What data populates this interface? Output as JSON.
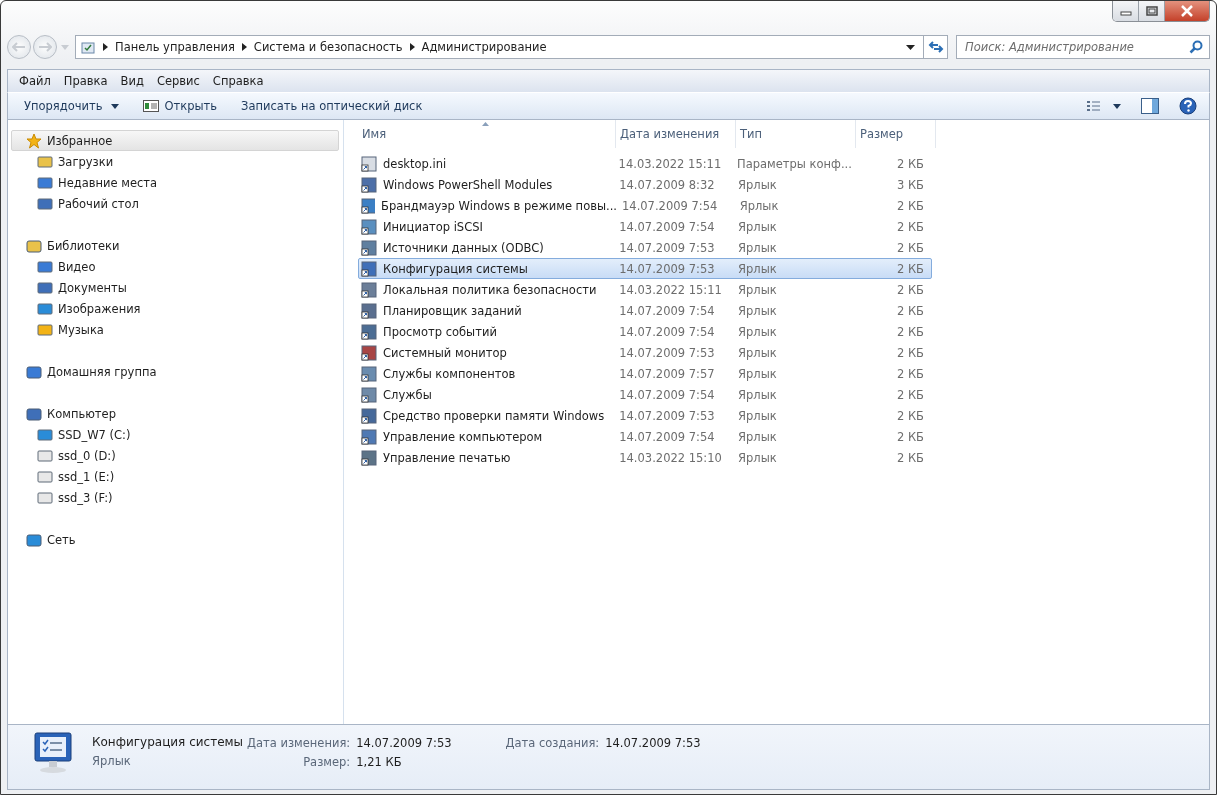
{
  "address_bar": {
    "breadcrumb": [
      "Панель управления",
      "Система и безопасность",
      "Администрирование"
    ]
  },
  "search": {
    "placeholder": "Поиск: Администрирование"
  },
  "menu": [
    "Файл",
    "Правка",
    "Вид",
    "Сервис",
    "Справка"
  ],
  "toolbar": [
    {
      "label": "Упорядочить",
      "kind": "dropdown"
    },
    {
      "label": "Открыть",
      "kind": "icon"
    },
    {
      "label": "Записать на оптический диск",
      "kind": "plain"
    }
  ],
  "sidebar": [
    {
      "label": "Избранное",
      "selected": true,
      "children": [
        {
          "label": "Загрузки",
          "selected": false
        },
        {
          "label": "Недавние места",
          "selected": false
        },
        {
          "label": "Рабочий стол",
          "selected": false
        }
      ]
    },
    {
      "label": "Библиотеки",
      "selected": false,
      "children": [
        {
          "label": "Видео",
          "selected": false
        },
        {
          "label": "Документы",
          "selected": false
        },
        {
          "label": "Изображения",
          "selected": false
        },
        {
          "label": "Музыка",
          "selected": false
        }
      ]
    },
    {
      "label": "Домашняя группа",
      "selected": false
    },
    {
      "label": "Компьютер",
      "selected": false,
      "children": [
        {
          "label": "SSD_W7 (C:)",
          "selected": false
        },
        {
          "label": "ssd_0 (D:)",
          "selected": false
        },
        {
          "label": "ssd_1 (E:)",
          "selected": false
        },
        {
          "label": "ssd_3 (F:)",
          "selected": false
        }
      ]
    },
    {
      "label": "Сеть",
      "selected": false
    }
  ],
  "table": {
    "columns": [
      "Имя",
      "Дата изменения",
      "Тип",
      "Размер"
    ],
    "rows": [
      {
        "cells": [
          "desktop.ini",
          "14.03.2022 15:11",
          "Параметры конф...",
          "2 КБ"
        ],
        "selected": false
      },
      {
        "cells": [
          "Windows PowerShell Modules",
          "14.07.2009 8:32",
          "Ярлык",
          "3 КБ"
        ],
        "selected": false
      },
      {
        "cells": [
          "Брандмауэр Windows в режиме повы...",
          "14.07.2009 7:54",
          "Ярлык",
          "2 КБ"
        ],
        "selected": false
      },
      {
        "cells": [
          "Инициатор iSCSI",
          "14.07.2009 7:54",
          "Ярлык",
          "2 КБ"
        ],
        "selected": false
      },
      {
        "cells": [
          "Источники данных (ODBC)",
          "14.07.2009 7:53",
          "Ярлык",
          "2 КБ"
        ],
        "selected": false
      },
      {
        "cells": [
          "Конфигурация системы",
          "14.07.2009 7:53",
          "Ярлык",
          "2 КБ"
        ],
        "selected": true
      },
      {
        "cells": [
          "Локальная политика безопасности",
          "14.03.2022 15:11",
          "Ярлык",
          "2 КБ"
        ],
        "selected": false
      },
      {
        "cells": [
          "Планировщик заданий",
          "14.07.2009 7:54",
          "Ярлык",
          "2 КБ"
        ],
        "selected": false
      },
      {
        "cells": [
          "Просмотр событий",
          "14.07.2009 7:54",
          "Ярлык",
          "2 КБ"
        ],
        "selected": false
      },
      {
        "cells": [
          "Системный монитор",
          "14.07.2009 7:53",
          "Ярлык",
          "2 КБ"
        ],
        "selected": false
      },
      {
        "cells": [
          "Службы компонентов",
          "14.07.2009 7:57",
          "Ярлык",
          "2 КБ"
        ],
        "selected": false
      },
      {
        "cells": [
          "Службы",
          "14.07.2009 7:54",
          "Ярлык",
          "2 КБ"
        ],
        "selected": false
      },
      {
        "cells": [
          "Средство проверки памяти Windows",
          "14.07.2009 7:53",
          "Ярлык",
          "2 КБ"
        ],
        "selected": false
      },
      {
        "cells": [
          "Управление компьютером",
          "14.07.2009 7:54",
          "Ярлык",
          "2 КБ"
        ],
        "selected": false
      },
      {
        "cells": [
          "Управление печатью",
          "14.03.2022 15:10",
          "Ярлык",
          "2 КБ"
        ],
        "selected": false
      }
    ]
  },
  "details": {
    "name": "Конфигурация системы",
    "type": "Ярлык",
    "fields": [
      {
        "label": "Дата изменения:",
        "value": "14.07.2009 7:53"
      },
      {
        "label": "Размер:",
        "value": "1,21 КБ"
      },
      {
        "label": "Дата создания:",
        "value": "14.07.2009 7:53"
      }
    ]
  }
}
